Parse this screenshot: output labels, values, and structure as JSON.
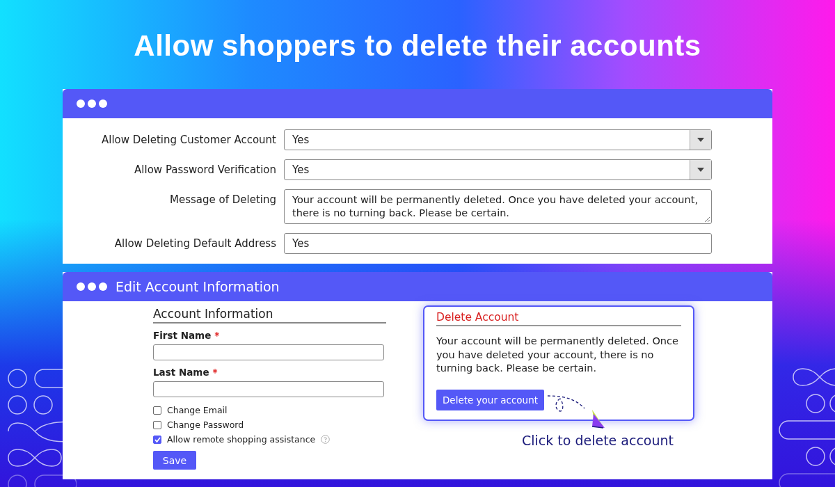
{
  "headline": "Allow shoppers to delete their accounts",
  "settings_panel": {
    "fields": [
      {
        "label": "Allow Deleting Customer Account",
        "kind": "dropdown",
        "value": "Yes"
      },
      {
        "label": "Allow Password Verification",
        "kind": "dropdown",
        "value": "Yes"
      },
      {
        "label": "Message of Deleting",
        "kind": "textarea",
        "value": "Your account will be permanently deleted. Once you have deleted your account, there is no turning back. Please be certain."
      },
      {
        "label": "Allow Deleting Default Address",
        "kind": "text",
        "value": "Yes"
      }
    ]
  },
  "account_panel": {
    "title": "Edit Account Information",
    "section_title": "Account Information",
    "fields": [
      {
        "label": "First Name",
        "marker": "*"
      },
      {
        "label": "Last Name",
        "marker": "*"
      }
    ],
    "checkboxes": [
      {
        "label": "Change Email",
        "checked": false,
        "help": false
      },
      {
        "label": "Change Password",
        "checked": false,
        "help": false
      },
      {
        "label": "Allow remote shopping assistance",
        "checked": true,
        "help": true
      }
    ],
    "save_button": "Save",
    "delete_card": {
      "title": "Delete Account",
      "message": "Your account will be permanently deleted. Once you have deleted your account, there is no turning back. Please be certain.",
      "button": "Delete your account"
    },
    "caption": "Click to delete account"
  }
}
